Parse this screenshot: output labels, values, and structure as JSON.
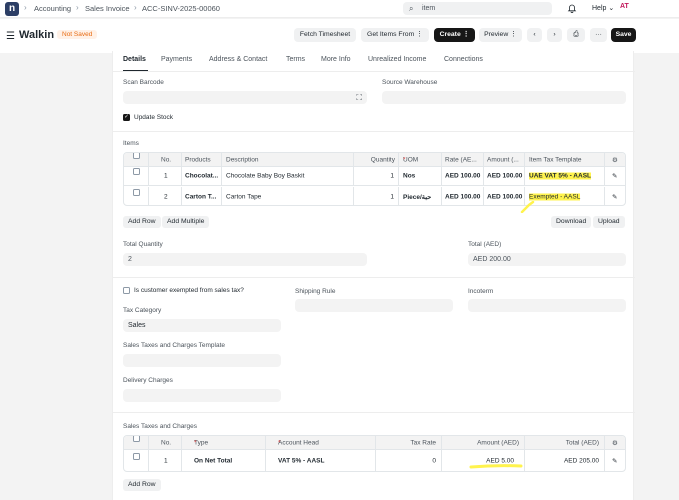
{
  "breadcrumbs": [
    "Accounting",
    "Sales Invoice",
    "ACC-SINV-2025-00060"
  ],
  "search": {
    "value": "item"
  },
  "navbar": {
    "help_label": "Help",
    "avatar_initials": "AT"
  },
  "page": {
    "title": "Walkin",
    "status": "Not Saved"
  },
  "actions": {
    "fetch_timesheet": "Fetch Timesheet",
    "get_items_from": "Get Items From",
    "create": "Create",
    "preview": "Preview",
    "save": "Save"
  },
  "tabs": [
    "Details",
    "Payments",
    "Address & Contact",
    "Terms",
    "More Info",
    "Unrealized Income",
    "Connections"
  ],
  "scan_barcode": {
    "label": "Scan Barcode",
    "value": ""
  },
  "source_warehouse": {
    "label": "Source Warehouse",
    "value": ""
  },
  "update_stock": {
    "label": "Update Stock",
    "checked": true
  },
  "items_section": {
    "label": "Items",
    "columns": [
      "No.",
      "Products",
      "Description",
      "Quantity",
      "UOM",
      "Rate (AE...",
      "Amount (...",
      "Item Tax Template"
    ],
    "rows": [
      {
        "no": "1",
        "product": "Chocolat...",
        "description": "Chocolate Baby Boy Baskit",
        "quantity": "1",
        "uom": "Nos",
        "rate": "AED 100.00",
        "amount": "AED 100.00",
        "tax_template": "UAE VAT 5% - AASL"
      },
      {
        "no": "2",
        "product": "Carton T...",
        "description": "Carton Tape",
        "quantity": "1",
        "uom": "Piece/حبة",
        "rate": "AED 100.00",
        "amount": "AED 100.00",
        "tax_template": "Exempted - AASL"
      }
    ],
    "add_row": "Add Row",
    "add_multiple": "Add Multiple",
    "download": "Download",
    "upload": "Upload"
  },
  "totals": {
    "total_quantity_label": "Total Quantity",
    "total_quantity": "2",
    "total_label": "Total (AED)",
    "total": "AED 200.00"
  },
  "tax_section": {
    "exempted_label": "Is customer exempted from sales tax?",
    "shipping_rule_label": "Shipping Rule",
    "incoterm_label": "Incoterm",
    "tax_category_label": "Tax Category",
    "tax_category": "Sales",
    "template_label": "Sales Taxes and Charges Template",
    "delivery_charges_label": "Delivery Charges"
  },
  "taxes_table": {
    "label": "Sales Taxes and Charges",
    "columns": [
      "No.",
      "Type",
      "Account Head",
      "Tax Rate",
      "Amount (AED)",
      "Total (AED)"
    ],
    "rows": [
      {
        "no": "1",
        "type": "On Net Total",
        "account_head": "VAT 5% - AASL",
        "tax_rate": "0",
        "amount": "AED 5.00",
        "total": "AED 205.00"
      }
    ],
    "add_row": "Add Row"
  },
  "colors": {
    "annotation_highlight": "#fff34d",
    "primary_button": "#171717",
    "not_saved_badge": "#e86c13"
  }
}
